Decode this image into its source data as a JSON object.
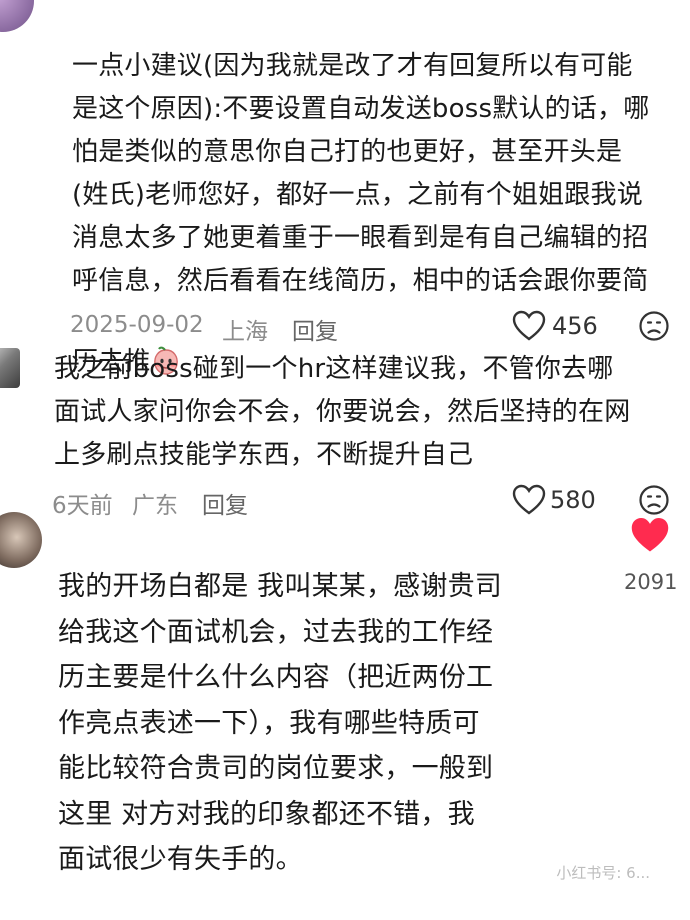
{
  "comments": [
    {
      "text": "一点小建议(因为我就是改了才有回复所以有可能\n是这个原因):不要设置自动发送boss默认的话，哪\n怕是类似的意思你自己打的也更好，甚至开头是\n(姓氏)老师您好，都好一点，之前有个姐姐跟我说\n消息太多了她更着重于一眼看到是有自己编辑的招\n呼信息，然后看看在线简历，相中的话会跟你要简\n历去推",
      "emoji": "peach-shy-emoji",
      "date": "2025-09-02",
      "location": "上海",
      "reply_label": "回复",
      "likes": "456"
    },
    {
      "text": "我之前boss碰到一个hr这样建议我，不管你去哪\n面试人家问你会不会，你要说会，然后坚持的在网\n上多刷点技能学东西，不断提升自己",
      "date": "6天前",
      "location": "广东",
      "reply_label": "回复",
      "likes": "580"
    },
    {
      "text": "我的开场白都是 我叫某某，感谢贵司\n给我这个面试机会，过去我的工作经\n历主要是什么什么内容（把近两份工\n作亮点表述一下），我有哪些特质可\n能比较符合贵司的岗位要求，一般到\n这里  对方对我的印象都还不错，我\n面试很少有失手的。",
      "likes": "2091"
    }
  ],
  "icons": {
    "like": "heart-outline-icon",
    "liked": "heart-filled-icon",
    "dislike": "unhappy-face-icon"
  },
  "colors": {
    "heart_red": "#ff2b4f",
    "meta_gray": "#8c8c8c"
  },
  "watermark": "小红书号: 6... "
}
